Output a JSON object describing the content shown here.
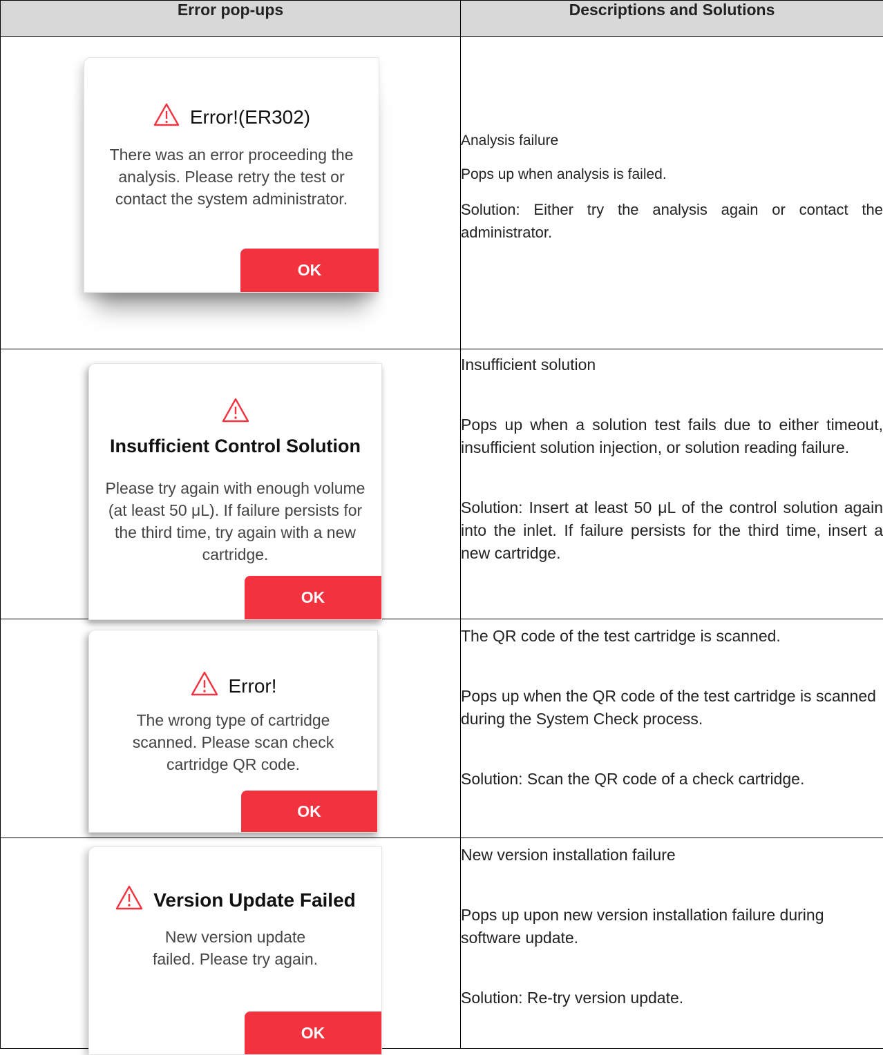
{
  "table": {
    "header_left": "Error pop-ups",
    "header_right": "Descriptions and Solutions"
  },
  "rows": [
    {
      "popup": {
        "title": "Error!(ER302)",
        "message": "There was an error proceeding the analysis. Please retry the test or contact the system administrator.",
        "ok_label": "OK"
      },
      "description": {
        "heading": "Analysis failure",
        "detail": "Pops up when analysis is failed.",
        "solution": "Solution: Either try the analysis again or contact the administrator."
      }
    },
    {
      "popup": {
        "title": "Insufficient Control Solution",
        "message": "Please try again with enough volume (at least 50 μL). If failure persists for the third time, try again with a new cartridge.",
        "ok_label": "OK"
      },
      "description": {
        "heading": "Insufficient solution",
        "detail": "Pops up when a solution test fails due to either timeout, insufficient solution injection, or solution reading failure.",
        "solution": "Solution: Insert at least 50 μL of the control solution again into the inlet. If failure persists for the third time, insert a new cartridge."
      }
    },
    {
      "popup": {
        "title": "Error!",
        "message": "The wrong type of cartridge scanned. Please scan check cartridge QR code.",
        "ok_label": "OK"
      },
      "description": {
        "heading": "The QR code of the test cartridge is scanned.",
        "detail": "Pops up when the QR code of the test cartridge is scanned during the System Check process.",
        "solution": "Solution: Scan the QR code of a check cartridge."
      }
    },
    {
      "popup": {
        "title": "Version Update Failed",
        "message": "New version update failed. Please try again.",
        "ok_label": "OK"
      },
      "description": {
        "heading": "New version installation failure",
        "detail": "Pops up upon new version installation failure during software update.",
        "solution": "Solution: Re-try version update."
      }
    }
  ],
  "colors": {
    "accent_red": "#f2323f",
    "header_bg": "#d8d8d8"
  },
  "icons": [
    "warning-triangle-icon"
  ]
}
